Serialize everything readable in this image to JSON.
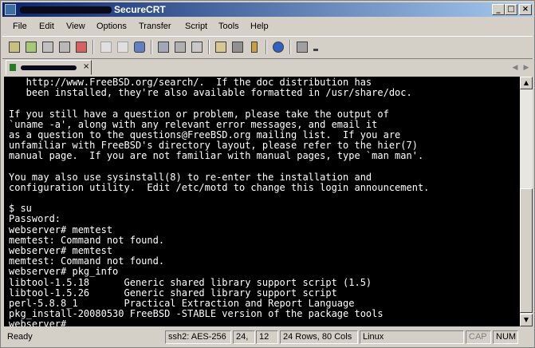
{
  "window": {
    "title": "SecureCRT"
  },
  "title_buttons": {
    "minimize": "_",
    "maximize": "□",
    "close": "×"
  },
  "menu": [
    {
      "id": "file",
      "label": "File"
    },
    {
      "id": "edit",
      "label": "Edit"
    },
    {
      "id": "view",
      "label": "View"
    },
    {
      "id": "options",
      "label": "Options"
    },
    {
      "id": "transfer",
      "label": "Transfer"
    },
    {
      "id": "script",
      "label": "Script"
    },
    {
      "id": "tools",
      "label": "Tools"
    },
    {
      "id": "help",
      "label": "Help"
    }
  ],
  "toolbar_icons": [
    "connect-icon",
    "quick-connect-icon",
    "connect-in-tab-icon",
    "reconnect-icon",
    "disconnect-icon",
    "copy-icon",
    "paste-icon",
    "find-icon",
    "print-icon",
    "print-selection-icon",
    "print-setup-icon",
    "session-options-icon",
    "keymap-editor-icon",
    "keygen-icon",
    "help-icon",
    "sftp-icon"
  ],
  "tab": {
    "close_glyph": "×"
  },
  "terminal": {
    "background": "#000000",
    "foreground": "#ffffff",
    "lines": [
      "   http://www.FreeBSD.org/search/.  If the doc distribution has",
      "   been installed, they're also available formatted in /usr/share/doc.",
      "",
      "If you still have a question or problem, please take the output of",
      "`uname -a', along with any relevant error messages, and email it",
      "as a question to the questions@FreeBSD.org mailing list.  If you are",
      "unfamiliar with FreeBSD's directory layout, please refer to the hier(7)",
      "manual page.  If you are not familiar with manual pages, type `man man'.",
      "",
      "You may also use sysinstall(8) to re-enter the installation and",
      "configuration utility.  Edit /etc/motd to change this login announcement.",
      "",
      "$ su",
      "Password:",
      "webserver# memtest",
      "memtest: Command not found.",
      "webserver# memtest",
      "memtest: Command not found.",
      "webserver# pkg_info",
      "libtool-1.5.18      Generic shared library support script (1.5)",
      "libtool-1.5.26      Generic shared library support script",
      "perl-5.8.8_1        Practical Extraction and Report Language",
      "pkg_install-20080530 FreeBSD -STABLE version of the package tools",
      "webserver#"
    ]
  },
  "status": {
    "state": "Ready",
    "protocol": "ssh2: AES-256",
    "row": "24,",
    "col": "12",
    "size": "24 Rows,  80 Cols",
    "term": "Linux",
    "cap": "CAP",
    "num": "NUM"
  }
}
